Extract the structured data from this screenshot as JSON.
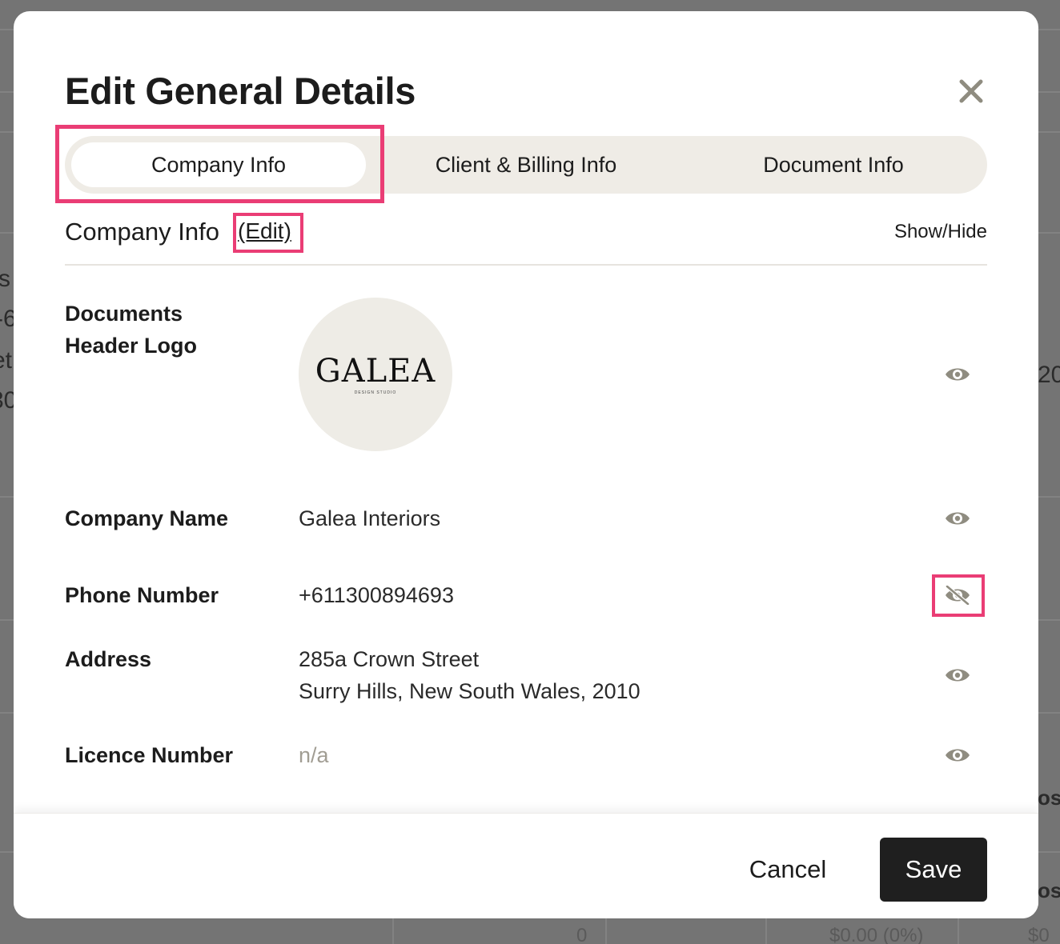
{
  "background": {
    "fragments": [
      "s",
      "-6",
      "et",
      "30",
      "20",
      "ose",
      "ost"
    ],
    "cells": [
      "0",
      "$0.00 (0%)",
      "$0"
    ]
  },
  "modal": {
    "title": "Edit General Details",
    "close_icon": "close-icon"
  },
  "tabs": [
    {
      "label": "Company Info",
      "active": true
    },
    {
      "label": "Client & Billing Info",
      "active": false
    },
    {
      "label": "Document Info",
      "active": false
    }
  ],
  "section": {
    "title": "Company Info",
    "edit_label": "(Edit)",
    "show_hide_label": "Show/Hide"
  },
  "rows": {
    "logo": {
      "label_line1": "Documents",
      "label_line2": "Header Logo",
      "logo_text": "GALEA",
      "logo_subtext": "DESIGN STUDIO",
      "visible": true
    },
    "company_name": {
      "label": "Company Name",
      "value": "Galea Interiors",
      "visible": true
    },
    "phone": {
      "label": "Phone Number",
      "value": "+611300894693",
      "visible": false
    },
    "address": {
      "label": "Address",
      "line1": "285a Crown Street",
      "line2": "Surry Hills, New South Wales, 2010",
      "visible": true
    },
    "licence": {
      "label": "Licence Number",
      "value": "n/a",
      "visible": true
    }
  },
  "footer": {
    "cancel_label": "Cancel",
    "save_label": "Save"
  },
  "colors": {
    "highlight": "#ea3d75",
    "icon": "#8f8c80",
    "tab_track": "#efece6",
    "save_bg": "#1f1f1f"
  }
}
